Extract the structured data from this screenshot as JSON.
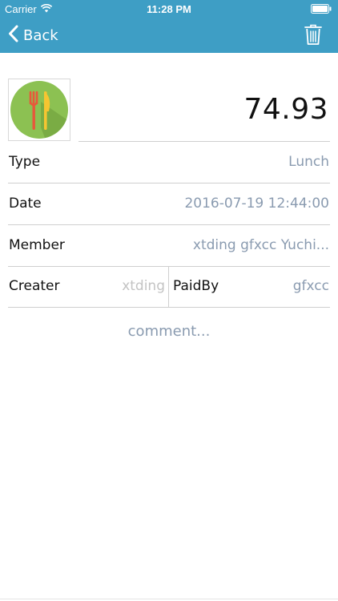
{
  "status_bar": {
    "carrier": "Carrier",
    "time": "11:28 PM"
  },
  "nav": {
    "back_label": "Back",
    "back_icon": "chevron-left-icon",
    "delete_icon": "trash-icon"
  },
  "expense": {
    "category_icon": "fork-knife-icon",
    "amount": "74.93"
  },
  "fields": {
    "type": {
      "label": "Type",
      "value": "Lunch"
    },
    "date": {
      "label": "Date",
      "value": "2016-07-19 12:44:00"
    },
    "member": {
      "label": "Member",
      "value": "xtding gfxcc Yuchi..."
    },
    "creater": {
      "label": "Creater",
      "value": "xtding"
    },
    "paid_by": {
      "label": "PaidBy",
      "value": "gfxcc"
    }
  },
  "comment": {
    "placeholder": "comment..."
  },
  "colors": {
    "nav_background": "#3e9ec5",
    "value_text": "#8a9bb0",
    "icon_circle": "#8cc152",
    "icon_fork": "#e8583b",
    "icon_knife": "#f6c531"
  }
}
